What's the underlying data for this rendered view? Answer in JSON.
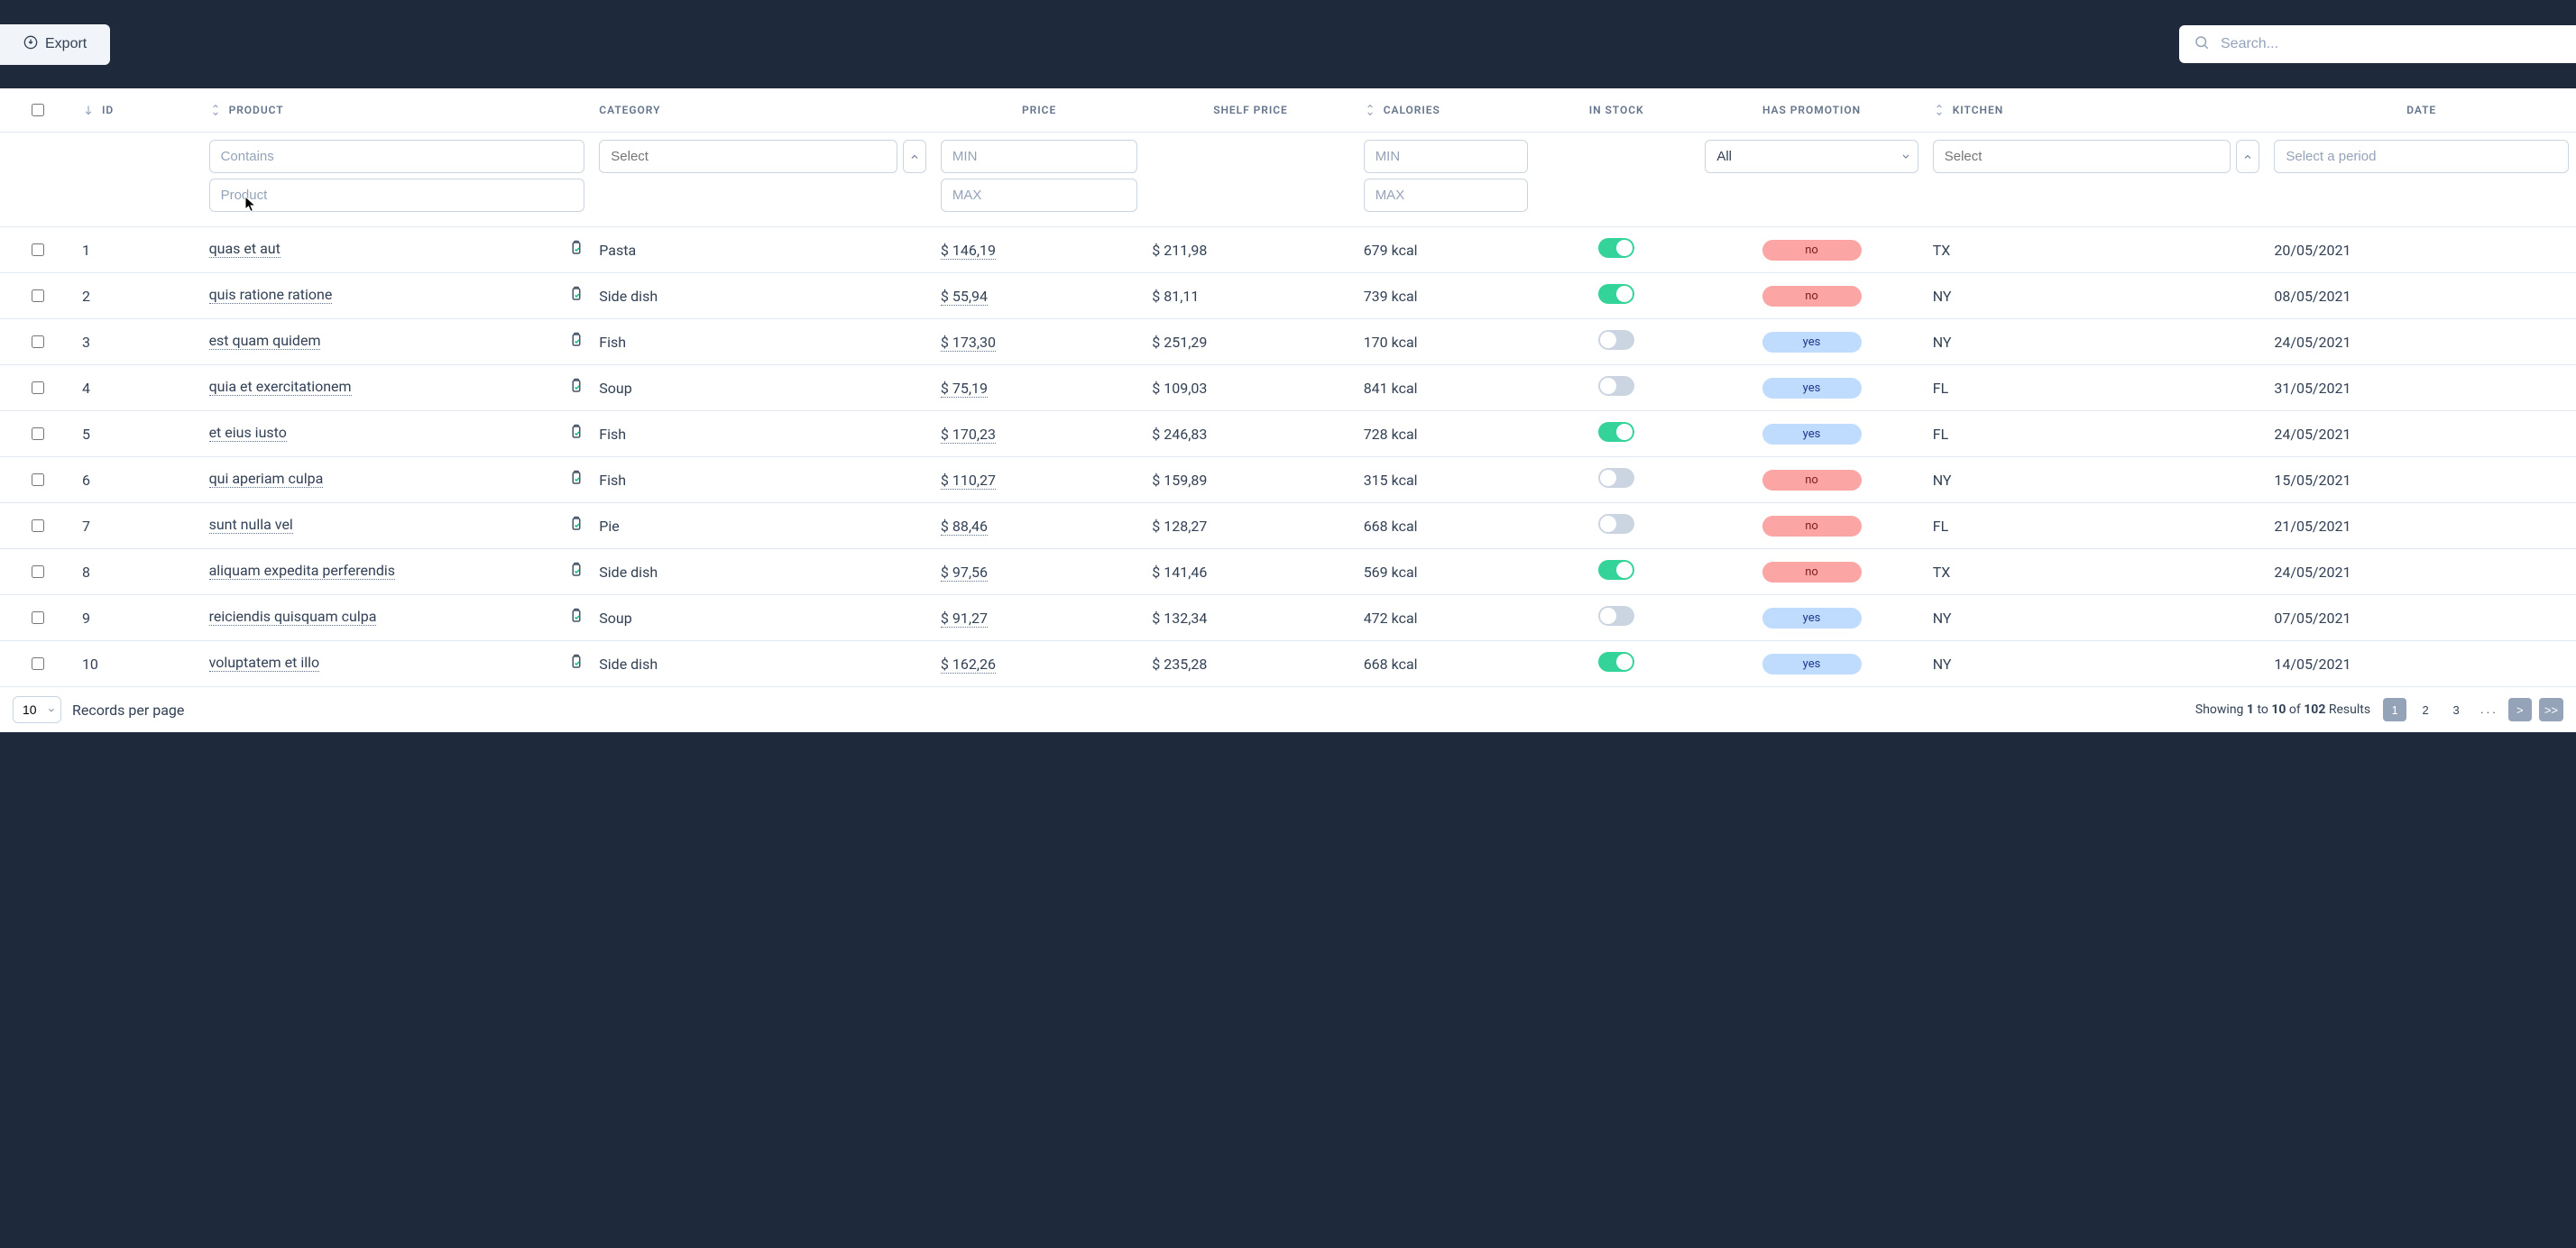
{
  "toolbar": {
    "export_label": "Export",
    "search_placeholder": "Search..."
  },
  "columns": {
    "id": "ID",
    "product": "PRODUCT",
    "category": "CATEGORY",
    "price": "PRICE",
    "shelf_price": "SHELF PRICE",
    "calories": "CALORIES",
    "in_stock": "IN STOCK",
    "has_promotion": "HAS PROMOTION",
    "kitchen": "KITCHEN",
    "date": "DATE"
  },
  "filters": {
    "contains_placeholder": "Contains",
    "product_placeholder": "Product",
    "category_placeholder": "Select",
    "min_placeholder": "MIN",
    "max_placeholder": "MAX",
    "promo_value": "All",
    "kitchen_placeholder": "Select",
    "date_placeholder": "Select a period"
  },
  "rows": [
    {
      "id": "1",
      "product": "quas et aut",
      "category": "Pasta",
      "price": "$ 146,19",
      "shelf_price": "$ 211,98",
      "calories": "679 kcal",
      "in_stock": true,
      "promotion": "no",
      "kitchen": "TX",
      "date": "20/05/2021"
    },
    {
      "id": "2",
      "product": "quis ratione ratione",
      "category": "Side dish",
      "price": "$ 55,94",
      "shelf_price": "$ 81,11",
      "calories": "739 kcal",
      "in_stock": true,
      "promotion": "no",
      "kitchen": "NY",
      "date": "08/05/2021"
    },
    {
      "id": "3",
      "product": "est quam quidem",
      "category": "Fish",
      "price": "$ 173,30",
      "shelf_price": "$ 251,29",
      "calories": "170 kcal",
      "in_stock": false,
      "promotion": "yes",
      "kitchen": "NY",
      "date": "24/05/2021"
    },
    {
      "id": "4",
      "product": "quia et exercitationem",
      "category": "Soup",
      "price": "$ 75,19",
      "shelf_price": "$ 109,03",
      "calories": "841 kcal",
      "in_stock": false,
      "promotion": "yes",
      "kitchen": "FL",
      "date": "31/05/2021"
    },
    {
      "id": "5",
      "product": "et eius iusto",
      "category": "Fish",
      "price": "$ 170,23",
      "shelf_price": "$ 246,83",
      "calories": "728 kcal",
      "in_stock": true,
      "promotion": "yes",
      "kitchen": "FL",
      "date": "24/05/2021"
    },
    {
      "id": "6",
      "product": "qui aperiam culpa",
      "category": "Fish",
      "price": "$ 110,27",
      "shelf_price": "$ 159,89",
      "calories": "315 kcal",
      "in_stock": false,
      "promotion": "no",
      "kitchen": "NY",
      "date": "15/05/2021"
    },
    {
      "id": "7",
      "product": "sunt nulla vel",
      "category": "Pie",
      "price": "$ 88,46",
      "shelf_price": "$ 128,27",
      "calories": "668 kcal",
      "in_stock": false,
      "promotion": "no",
      "kitchen": "FL",
      "date": "21/05/2021"
    },
    {
      "id": "8",
      "product": "aliquam expedita perferendis",
      "category": "Side dish",
      "price": "$ 97,56",
      "shelf_price": "$ 141,46",
      "calories": "569 kcal",
      "in_stock": true,
      "promotion": "no",
      "kitchen": "TX",
      "date": "24/05/2021"
    },
    {
      "id": "9",
      "product": "reiciendis quisquam culpa",
      "category": "Soup",
      "price": "$ 91,27",
      "shelf_price": "$ 132,34",
      "calories": "472 kcal",
      "in_stock": false,
      "promotion": "yes",
      "kitchen": "NY",
      "date": "07/05/2021"
    },
    {
      "id": "10",
      "product": "voluptatem et illo",
      "category": "Side dish",
      "price": "$ 162,26",
      "shelf_price": "$ 235,28",
      "calories": "668 kcal",
      "in_stock": true,
      "promotion": "yes",
      "kitchen": "NY",
      "date": "14/05/2021"
    }
  ],
  "pagination": {
    "per_page": "10",
    "per_page_label": "Records per page",
    "showing_prefix": "Showing",
    "from": "1",
    "to_word": "to",
    "to": "10",
    "of_word": "of",
    "total": "102",
    "results_word": "Results",
    "pages": [
      "1",
      "2",
      "3"
    ],
    "ellipsis": ". . .",
    "next": ">",
    "last": ">>"
  }
}
